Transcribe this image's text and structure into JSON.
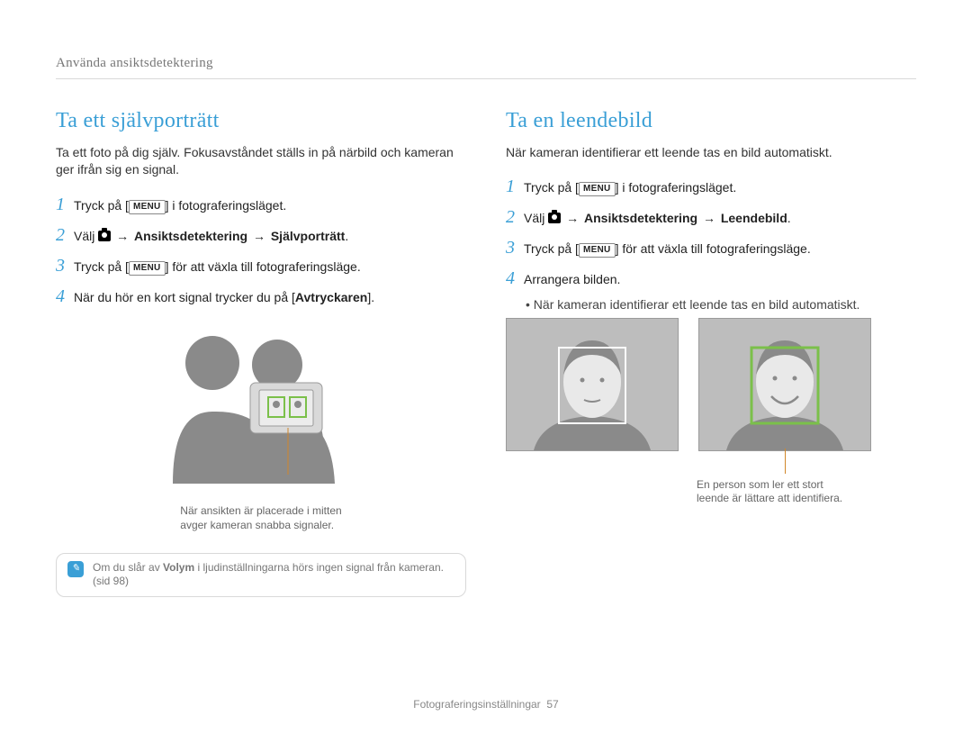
{
  "running_head": "Använda ansiktsdetektering",
  "left": {
    "title": "Ta ett självporträtt",
    "lead": "Ta ett foto på dig själv. Fokusavståndet ställs in på närbild och kameran ger ifrån sig en signal.",
    "steps": {
      "s1_pre": "Tryck på [",
      "s1_post": "] i fotograferingsläget.",
      "s2_pre": "Välj ",
      "s2_mid1": "Ansiktsdetektering",
      "s2_tail": "Självporträtt",
      "s3_pre": "Tryck på [",
      "s3_post": "] för att växla till fotograferingsläge.",
      "s4_pre": "När du hör en kort signal trycker du på [",
      "s4_bold": "Avtryckaren",
      "s4_post": "]."
    },
    "caption": {
      "line1": "När ansikten är placerade i mitten",
      "line2": "avger kameran snabba signaler."
    },
    "note": {
      "pre": "Om du slår av ",
      "bold": "Volym",
      "post": " i ljudinställningarna hörs ingen signal från kameran.",
      "p2": "(sid 98)"
    }
  },
  "right": {
    "title": "Ta en leendebild",
    "lead": "När kameran identifierar ett leende tas en bild automatiskt.",
    "steps": {
      "s1_pre": "Tryck på [",
      "s1_post": "] i fotograferingsläget.",
      "s2_pre": "Välj ",
      "s2_mid1": "Ansiktsdetektering",
      "s2_tail": "Leendebild",
      "s3_pre": "Tryck på [",
      "s3_post": "] för att växla till fotograferingsläge.",
      "s4": "Arrangera bilden.",
      "bullet": "När kameran identifierar ett leende tas en bild automatiskt."
    },
    "thumbs_caption": {
      "line1": "En person som ler ett stort",
      "line2": "leende är lättare att identifiera."
    }
  },
  "ui": {
    "menu_label": "MENU",
    "arrow": "→"
  },
  "footer": {
    "section": "Fotograferingsinställningar",
    "page": "57"
  }
}
